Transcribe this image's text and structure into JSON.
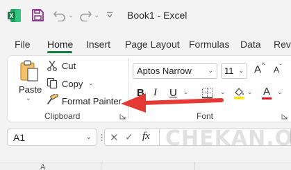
{
  "app": {
    "title": "Book1  -  Excel",
    "logo_icon": "excel-logo-icon",
    "accent_color": "#107c41"
  },
  "quick_access": {
    "save_icon": "save-icon",
    "undo_icon": "undo-icon",
    "redo_icon": "redo-icon"
  },
  "tabs": [
    {
      "label": "File"
    },
    {
      "label": "Home",
      "active": true
    },
    {
      "label": "Insert"
    },
    {
      "label": "Page Layout"
    },
    {
      "label": "Formulas"
    },
    {
      "label": "Data"
    },
    {
      "label": "Revi"
    }
  ],
  "clipboard": {
    "paste_label": "Paste",
    "cut_label": "Cut",
    "copy_label": "Copy",
    "format_painter_label": "Format Painter",
    "group_label": "Clipboard"
  },
  "font": {
    "name": "Aptos Narrow",
    "size": "11",
    "bold_label": "B",
    "italic_label": "I",
    "underline_label": "U",
    "grow_label": "A",
    "shrink_label": "A",
    "font_color_label": "A",
    "font_color": "#e81123",
    "fill_color": "#ffe400",
    "group_label": "Font"
  },
  "formula_bar": {
    "name_box_value": "A1",
    "fx_label": "fx"
  },
  "watermark": "CHEKAN.ORG",
  "annotation": {
    "arrow_color": "#e53935",
    "points_to": "format-painter-button"
  },
  "columns": [
    "A"
  ]
}
